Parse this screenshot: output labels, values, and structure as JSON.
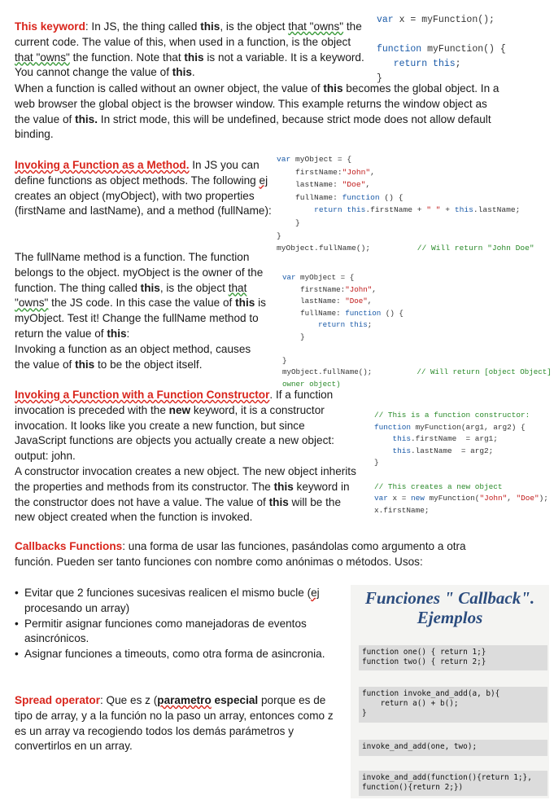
{
  "sec1": {
    "title": "This keyword",
    "t1": ": In JS, the thing called ",
    "b1": "this",
    "t2": ", is the object ",
    "sq1": "that \"owns\"",
    "t3": " the current code. The value of this, when used in a function, is the object ",
    "sq2": "that \"owns\"",
    "t4": " the function. Note that ",
    "b2": "this",
    "t5": " is not a variable. It is a keyword. You cannot change the value of ",
    "b3": "this",
    "t6": ".",
    "t7": "When a function is called without an owner object, the value of ",
    "b4": "this",
    "t8": " becomes the global object. In a web browser the global object is the browser window. This example returns the window object as the value of ",
    "b5": "this.",
    "t9": " In strict mode, this will be undefined, because strict mode does not allow default binding."
  },
  "code1": {
    "l1a": "var",
    "l1b": " x = myFunction();",
    "l2a": "function",
    "l2b": " myFunction() {",
    "l3a": "return",
    "l3b": "this",
    "l3c": ";",
    "l4": "}"
  },
  "sec2": {
    "title": "Invoking a Function as a Method.",
    "t1": " In JS you can define functions as object methods. The following ",
    "sq1": "ej",
    "t2": " creates an object (myObject), with two properties (firstName and lastName), and a method (fullName):"
  },
  "code2": {
    "l1a": "var",
    "l1b": " myObject = {",
    "l2a": "firstName:",
    "l2b": "\"John\"",
    "l2c": ",",
    "l3a": "lastName: ",
    "l3b": "\"Doe\"",
    "l3c": ",",
    "l4a": "fullName: ",
    "l4b": "function",
    "l4c": " () {",
    "l5a": "return",
    "l5b": "this",
    "l5c": ".firstName + ",
    "l5d": "\" \"",
    "l5e": " + ",
    "l5f": "this",
    "l5g": ".lastName;",
    "l6": "}",
    "l7": "}",
    "l8a": "myObject.fullName();",
    "l8b": "// Will return \"John Doe\""
  },
  "sec3": {
    "t1": "The fullName method is a function. The function belongs to the object. myObject is the owner of the function. The thing called ",
    "b1": "this",
    "t2": ", is the object ",
    "sq1": "that \"owns\"",
    "t3": " the JS code. In this case the value of ",
    "b2": "this",
    "t4": " is myObject. Test it! Change the fullName method to return the value of ",
    "b3": "this",
    "t5": ":",
    "t6": "Invoking a function as an object method, causes the value of ",
    "b4": "this",
    "t7": " to be the object itself."
  },
  "code3": {
    "l1a": "var",
    "l1b": " myObject = {",
    "l2a": "firstName:",
    "l2b": "\"John\"",
    "l2c": ",",
    "l3a": "lastName: ",
    "l3b": "\"Doe\"",
    "l3c": ",",
    "l4a": "fullName: ",
    "l4b": "function",
    "l4c": " () {",
    "l5a": "return",
    "l5b": "this",
    "l5c": ";",
    "l6": "}",
    "l7": "}",
    "l8a": "myObject.fullName();",
    "l8b": "// Will return [object Object]",
    "l9": "owner object)"
  },
  "sec4": {
    "title": "Invoking a Function with a Function Constructor",
    "t1": ". If a function invocation is preceded with the ",
    "b1": "new",
    "t2": " keyword, it is a constructor invocation. It looks like you create a new function, but since JavaScript functions are objects you actually create a new object: output: john.",
    "t3": "A constructor invocation creates a new object. The new object inherits the properties and methods from its constructor. The ",
    "b2": "this",
    "t4": " keyword in the constructor does not have a value. The value of ",
    "b3": "this",
    "t5": " will be the new object created when the function is invoked."
  },
  "code4": {
    "l1": "// This is a function constructor:",
    "l2a": "function",
    "l2b": " myFunction(arg1, arg2) {",
    "l3a": "this",
    "l3b": ".firstName  = arg1;",
    "l4a": "this",
    "l4b": ".lastName  = arg2;",
    "l5": "}",
    "l6": "// This creates a new object",
    "l7a": "var",
    "l7b": " x = ",
    "l7c": "new",
    "l7d": " myFunction(",
    "l7e": "\"John\"",
    "l7f": ", ",
    "l7g": "\"Doe\"",
    "l7h": ");",
    "l8": "x.firstName;"
  },
  "sec5": {
    "title": "Callbacks Functions",
    "t1": ": una forma de usar las funciones, pasándolas como argumento a otra función. Pueden ser tanto funciones con nombre como anónimas o métodos. Usos:",
    "b1a": "Evitar que 2 funciones sucesivas realicen el mismo bucle (",
    "b1sq": "ej",
    "b1b": " procesando un array)",
    "b2": "Permitir asignar funciones como manejadoras de eventos asincrónicos.",
    "b3": "Asignar funciones a timeouts, como otra forma de asincronia."
  },
  "sec6": {
    "title": "Spread operator",
    "t1": ": Que es z (",
    "sq1": "parametro",
    "b1": " especial",
    "t2": " porque es de tipo de array, y a la función no la paso un array, entonces como z es un array va recogiendo todos los demás parámetros y convertirlos en un array."
  },
  "slide": {
    "title1": "Funciones \" Callback\".",
    "title2": "Ejemplos",
    "box1": "function one() { return 1;}\nfunction two() { return 2;}",
    "box2": "function invoke_and_add(a, b){\n    return a() + b();\n}",
    "box3": "invoke_and_add(one, two);",
    "box4": "invoke_and_add(function(){return 1;},\nfunction(){return 2;})"
  }
}
